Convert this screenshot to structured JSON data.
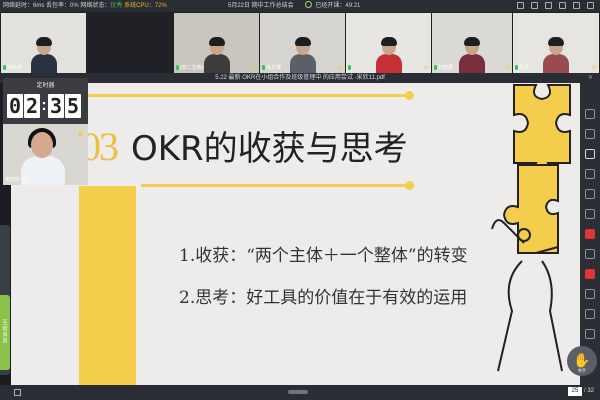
{
  "topbar": {
    "latency_label": "网络延时：",
    "latency_value": "6ms",
    "loss_label": "丢包率：",
    "loss_value": "0%",
    "net_label": "网络状态：",
    "net_value": "优秀",
    "cpu_label": "系统CPU：",
    "cpu_value": "72%",
    "meeting_title": "5月22日 期中工作总结会",
    "elapsed_label": "已经开课：",
    "elapsed_value": "49:21"
  },
  "participants": [
    {
      "name": "刘永奇",
      "badge": ""
    },
    {
      "name": "(初二生物)",
      "badge": "x0"
    },
    {
      "name": "徐文博",
      "badge": "x0"
    },
    {
      "name": "",
      "badge": "x0"
    },
    {
      "name": "刘丽君",
      "badge": "x0"
    },
    {
      "name": "张月",
      "badge": "x0"
    }
  ],
  "timer": {
    "title": "定时器",
    "digits": [
      "0",
      "2",
      "3",
      "5"
    ],
    "host_name": "宋欣欣",
    "host_badge": "x0"
  },
  "slide_window_title": "5.22 最新 OKR在小组合作及班级管理中 的应用尝试 -宋欣11.pdf",
  "slide": {
    "number": "03",
    "heading": "OKR的收获与思考",
    "point1": "1.收获：“两个主体＋一个整体”的转变",
    "point2": "2.思考：好工具的价值在于有效的运用"
  },
  "side_tab_label": "互动 消息",
  "hand_label": "举手",
  "pagination": {
    "current": "25",
    "total": "/ 32"
  },
  "colors": {
    "accent": "#f3cd4b",
    "good": "#30c35a",
    "cpu": "#f1b52b"
  }
}
